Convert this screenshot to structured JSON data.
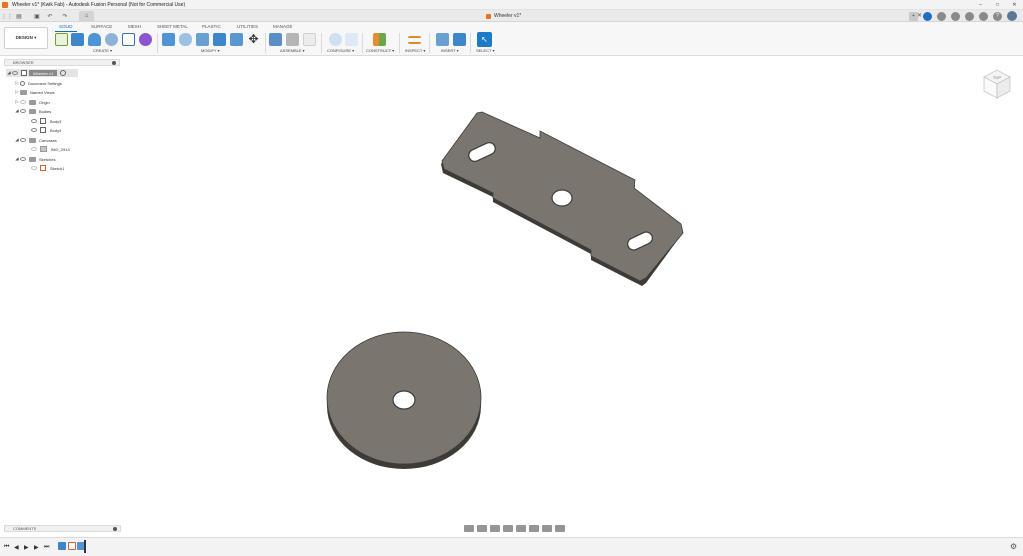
{
  "window": {
    "title": "Wheeler v1* (Kwik Fab) - Autodesk Fusion Personal (Not for Commercial Use)",
    "controls": [
      "–",
      "□",
      "✕"
    ]
  },
  "tabstrip": {
    "document_tab": "Wheeler v1*",
    "close_glyph": "✕"
  },
  "ribbon": {
    "workspace_button": "DESIGN ▾",
    "tabs": [
      "SOLID",
      "SURFACE",
      "MESH",
      "SHEET METAL",
      "PLASTIC",
      "UTILITIES",
      "MANAGE"
    ],
    "active_tab": "SOLID",
    "groups": [
      "CREATE ▾",
      "MODIFY ▾",
      "ASSEMBLE ▾",
      "CONFIGURE ▾",
      "CONSTRUCT ▾",
      "INSPECT ▾",
      "INSERT ▾",
      "SELECT ▾"
    ]
  },
  "browser": {
    "header": "BROWSER",
    "root": "Wheeler v1",
    "items": [
      {
        "label": "Document Settings"
      },
      {
        "label": "Named Views"
      },
      {
        "label": "Origin"
      },
      {
        "label": "Bodies"
      },
      {
        "label": "Body3"
      },
      {
        "label": "Body4"
      },
      {
        "label": "Canvases"
      },
      {
        "label": "IMG_2914"
      },
      {
        "label": "Sketches"
      },
      {
        "label": "Sketch1"
      }
    ]
  },
  "viewcube": {
    "face_label": "TOP"
  },
  "comments": {
    "header": "COMMENTS"
  },
  "colors": {
    "accent": "#0f6fbf",
    "fusion_orange": "#e8731e",
    "body_gray": "#7a766f",
    "body_edge": "#3e3b37"
  }
}
